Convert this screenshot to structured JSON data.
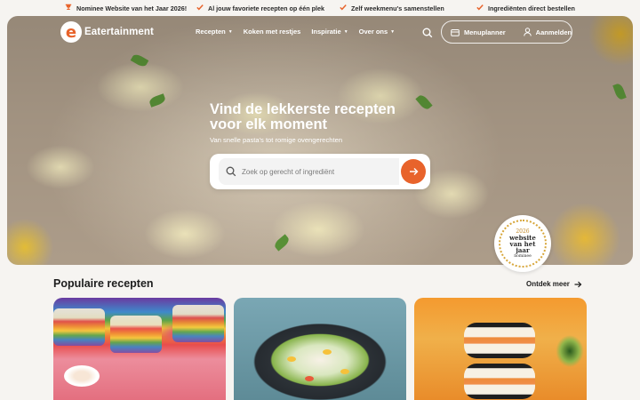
{
  "topbar": {
    "items": [
      {
        "icon": "trophy-icon",
        "text": "Nominee Website van het Jaar 2026!"
      },
      {
        "icon": "check-icon",
        "text": "Al jouw favoriete recepten op één plek"
      },
      {
        "icon": "check-icon",
        "text": "Zelf weekmenu's samenstellen"
      },
      {
        "icon": "check-icon",
        "text": "Ingrediënten direct bestellen"
      }
    ],
    "accent_color": "#e8632b"
  },
  "header": {
    "logo_letter": "e",
    "logo_text": "Eatertainment",
    "nav": [
      {
        "label": "Recepten",
        "has_dropdown": true
      },
      {
        "label": "Koken met restjes",
        "has_dropdown": false
      },
      {
        "label": "Inspiratie",
        "has_dropdown": true
      },
      {
        "label": "Over ons",
        "has_dropdown": true
      }
    ],
    "menuplanner_label": "Menuplanner",
    "login_label": "Aanmelden"
  },
  "hero": {
    "title": "Vind de lekkerste recepten voor elk moment",
    "subtitle": "Van snelle pasta's tot romige ovengerechten",
    "search_placeholder": "Zoek op gerecht of ingrediënt"
  },
  "badge": {
    "year": "2026",
    "line1": "website",
    "line2": "van het",
    "line3": "jaar",
    "foot": "nominee"
  },
  "popular": {
    "title": "Populaire recepten",
    "more_label": "Ontdek meer"
  }
}
